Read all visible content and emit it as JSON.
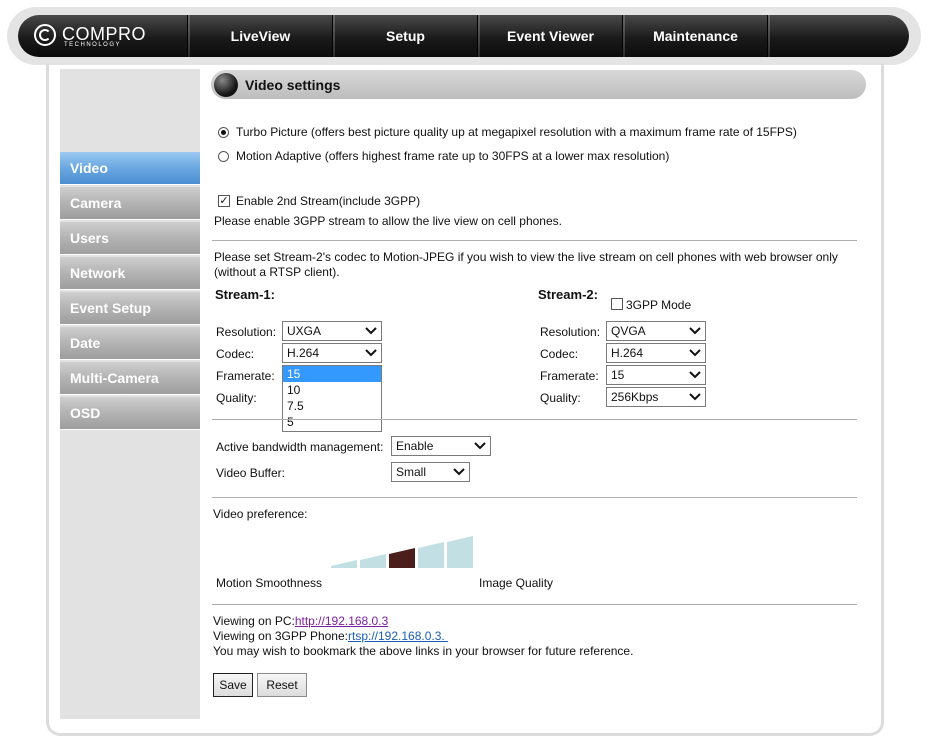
{
  "brand": {
    "name": "COMPRO",
    "sub": "TECHNOLOGY"
  },
  "nav": [
    "LiveView",
    "Setup",
    "Event Viewer",
    "Maintenance"
  ],
  "sidebar": [
    "Video",
    "Camera",
    "Users",
    "Network",
    "Event Setup",
    "Date",
    "Multi-Camera",
    "OSD"
  ],
  "page_title": "Video settings",
  "mode": {
    "turbo": "Turbo Picture (offers best picture quality up at megapixel resolution with a maximum frame rate of 15FPS)",
    "motion": "Motion Adaptive (offers highest frame rate up to 30FPS at a lower max resolution)",
    "selected": "turbo"
  },
  "second_stream": {
    "label": "Enable 2nd Stream(include 3GPP)",
    "checked": true,
    "note": "Please enable 3GPP stream to allow the live view on cell phones."
  },
  "codec_note_1": "Please set Stream-2's codec to Motion-JPEG if you wish to view the live stream on cell phones with web browser only",
  "codec_note_2": "(without a RTSP client).",
  "stream1": {
    "title": "Stream-1:",
    "labels": {
      "resolution": "Resolution:",
      "codec": "Codec:",
      "framerate": "Framerate:",
      "quality": "Quality:"
    },
    "resolution": "UXGA",
    "codec": "H.264",
    "framerate_options": [
      "15",
      "10",
      "7.5",
      "5"
    ],
    "framerate_selected": "15"
  },
  "stream2": {
    "title": "Stream-2:",
    "gpp_label": "3GPP Mode",
    "gpp_checked": false,
    "labels": {
      "resolution": "Resolution:",
      "codec": "Codec:",
      "framerate": "Framerate:",
      "quality": "Quality:"
    },
    "resolution": "QVGA",
    "codec": "H.264",
    "framerate": "15",
    "quality": "256Kbps"
  },
  "bandwidth": {
    "label": "Active bandwidth management:",
    "value": "Enable"
  },
  "buffer": {
    "label": "Video Buffer:",
    "value": "Small"
  },
  "preference": {
    "label": "Video preference:",
    "left": "Motion Smoothness",
    "right": "Image Quality",
    "levels": 5,
    "selected_level": 3,
    "colors": {
      "bar": "#c2e0e4",
      "selected": "#4a1e1a"
    }
  },
  "links": {
    "pc_label": "Viewing on PC:",
    "pc_url": "http://192.168.0.3",
    "phone_label": "Viewing on 3GPP Phone:",
    "phone_url": "rtsp://192.168.0.3. ",
    "note": "You may wish to bookmark the above links in your browser for future reference."
  },
  "buttons": {
    "save": "Save",
    "reset": "Reset"
  }
}
